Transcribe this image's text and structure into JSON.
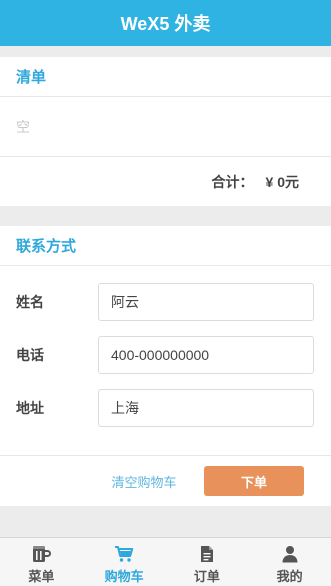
{
  "header": {
    "title": "WeX5 外卖"
  },
  "cart": {
    "title": "清单",
    "empty_text": "空",
    "total_label": "合计：",
    "total_value": "¥ 0元"
  },
  "contact": {
    "title": "联系方式",
    "fields": [
      {
        "label": "姓名",
        "value": "阿云"
      },
      {
        "label": "电话",
        "value": "400-000000000"
      },
      {
        "label": "地址",
        "value": "上海"
      }
    ],
    "clear_label": "清空购物车",
    "order_label": "下单"
  },
  "tabbar": {
    "items": [
      {
        "label": "菜单",
        "icon": "mug-icon"
      },
      {
        "label": "购物车",
        "icon": "cart-icon"
      },
      {
        "label": "订单",
        "icon": "document-icon"
      },
      {
        "label": "我的",
        "icon": "user-icon"
      }
    ],
    "active_index": 1
  },
  "colors": {
    "accent": "#2fb3e3",
    "order_button": "#e8915a",
    "background": "#ececec"
  }
}
